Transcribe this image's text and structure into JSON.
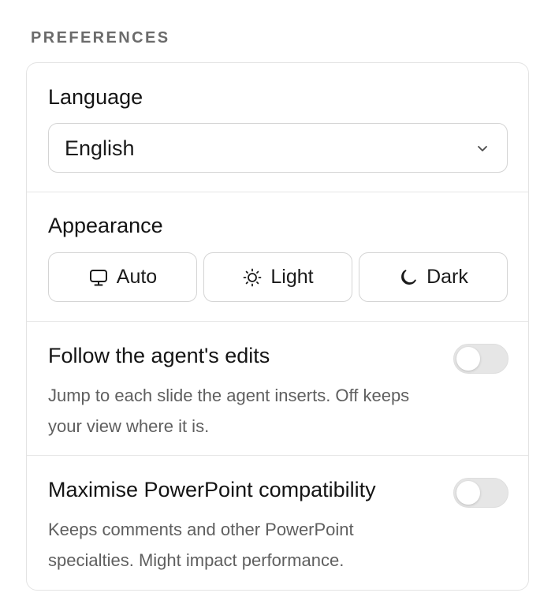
{
  "section": {
    "heading": "PREFERENCES"
  },
  "language": {
    "label": "Language",
    "selected": "English"
  },
  "appearance": {
    "label": "Appearance",
    "options": [
      {
        "label": "Auto",
        "icon": "monitor-icon"
      },
      {
        "label": "Light",
        "icon": "sun-icon"
      },
      {
        "label": "Dark",
        "icon": "moon-icon"
      }
    ]
  },
  "follow_edits": {
    "title": "Follow the agent's edits",
    "description": "Jump to each slide the agent inserts. Off keeps your view where it is.",
    "enabled": false
  },
  "compatibility": {
    "title": "Maximise PowerPoint compatibility",
    "description": "Keeps comments and other PowerPoint specialties. Might impact performance.",
    "enabled": false
  },
  "colors": {
    "border": "#e3e3e3",
    "toggle_off": "#e6e6e6",
    "heading": "#6b6b6b",
    "description": "#5f5f5f"
  }
}
